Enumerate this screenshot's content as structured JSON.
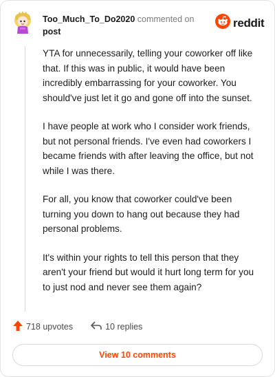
{
  "header": {
    "username": "Too_Much_To_Do2020",
    "commented_on": "commented on",
    "post_link": "post"
  },
  "logo": {
    "text": "reddit",
    "icon": "reddit-alien-icon",
    "color": "#ff4500"
  },
  "comment": {
    "paragraphs": [
      "YTA for unnecessarily, telling your coworker off like that. If this was in public, it would have been incredibly embarrassing for your coworker. You should've just let it go and gone off into the sunset.",
      "I have people at work who I consider work friends, but not personal friends. I've even had coworkers I became friends with after leaving the office, but not while I was there.",
      "For all, you know that coworker could've been turning you down to hang out because they had personal problems.",
      "It's within your rights to tell this person that they aren't your friend but would it hurt long term for you to just nod and never see them again?"
    ]
  },
  "actions": {
    "upvotes": "718 upvotes",
    "upvote_icon": "upvote-arrow-icon",
    "replies": "10 replies",
    "reply_icon": "reply-arrow-icon"
  },
  "view_button": {
    "label": "View 10 comments"
  },
  "colors": {
    "accent": "#ff4500",
    "text": "#1c1c1c",
    "muted": "#7c7c7c"
  }
}
